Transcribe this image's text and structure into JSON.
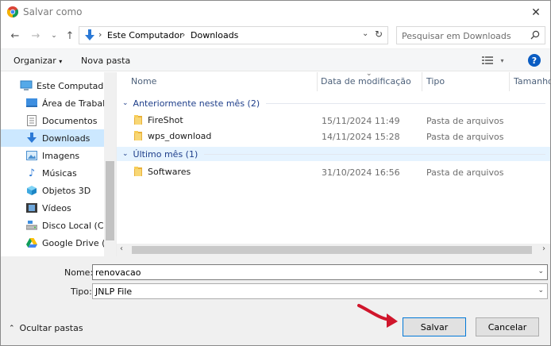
{
  "window": {
    "title": "Salvar como"
  },
  "address": {
    "crumbs": [
      "Este Computador",
      "Downloads"
    ]
  },
  "search": {
    "placeholder": "Pesquisar em Downloads"
  },
  "toolbar": {
    "organize_label": "Organizar",
    "new_folder_label": "Nova pasta"
  },
  "sidebar": {
    "items": [
      {
        "label": "Este Computador",
        "icon": "computer-icon"
      },
      {
        "label": "Área de Trabalho",
        "icon": "desktop-icon"
      },
      {
        "label": "Documentos",
        "icon": "documents-icon"
      },
      {
        "label": "Downloads",
        "icon": "downloads-icon",
        "selected": true
      },
      {
        "label": "Imagens",
        "icon": "pictures-icon"
      },
      {
        "label": "Músicas",
        "icon": "music-icon"
      },
      {
        "label": "Objetos 3D",
        "icon": "objects-3d-icon"
      },
      {
        "label": "Vídeos",
        "icon": "videos-icon"
      },
      {
        "label": "Disco Local (C:)",
        "icon": "drive-icon"
      },
      {
        "label": "Google Drive (G:",
        "icon": "google-drive-icon"
      }
    ]
  },
  "columns": {
    "name": "Nome",
    "date": "Data de modificação",
    "type": "Tipo",
    "size": "Tamanho"
  },
  "groups": [
    {
      "label": "Anteriormente neste mês (2)",
      "files": [
        {
          "name": "FireShot",
          "date": "15/11/2024 11:49",
          "type": "Pasta de arquivos"
        },
        {
          "name": "wps_download",
          "date": "14/11/2024 15:28",
          "type": "Pasta de arquivos"
        }
      ]
    },
    {
      "label": "Último mês (1)",
      "files": [
        {
          "name": "Softwares",
          "date": "31/10/2024 16:56",
          "type": "Pasta de arquivos"
        }
      ]
    }
  ],
  "form": {
    "name_label": "Nome:",
    "name_value": "renovacao",
    "type_label": "Tipo:",
    "type_value": "JNLP File",
    "hide_folders_label": "Ocultar pastas",
    "save_label": "Salvar",
    "cancel_label": "Cancelar"
  },
  "colors": {
    "accent": "#0078d7",
    "selected": "#cce8ff",
    "annotation_arrow": "#d0162c"
  }
}
